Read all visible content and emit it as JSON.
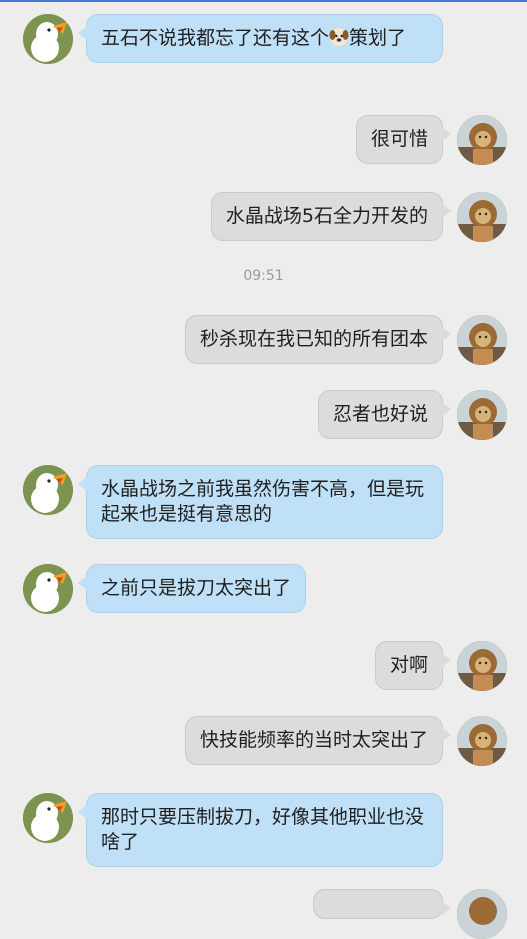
{
  "messages": [
    {
      "side": "left",
      "text_before": "五石不说我都忘了还有这个",
      "emoji": "dog-face",
      "text_after": "策划了"
    },
    {
      "side": "right",
      "text": "很可惜"
    },
    {
      "side": "right",
      "text": "水晶战场5石全力开发的"
    },
    {
      "type": "time",
      "text": "09:51"
    },
    {
      "side": "right",
      "text": "秒杀现在我已知的所有团本"
    },
    {
      "side": "right",
      "text": "忍者也好说"
    },
    {
      "side": "left",
      "text": "水晶战场之前我虽然伤害不高，但是玩起来也是挺有意思的"
    },
    {
      "side": "left",
      "text": "之前只是拔刀太突出了"
    },
    {
      "side": "right",
      "text": "对啊"
    },
    {
      "side": "right",
      "text": "快技能频率的当时太突出了"
    },
    {
      "side": "left",
      "text": "那时只要压制拔刀，好像其他职业也没啥了"
    }
  ],
  "avatars": {
    "left": "duck-avatar",
    "right": "lion-avatar"
  },
  "colors": {
    "left_bubble": "#bfe0f7",
    "right_bubble": "#dcdcdc",
    "background": "#ededed"
  }
}
